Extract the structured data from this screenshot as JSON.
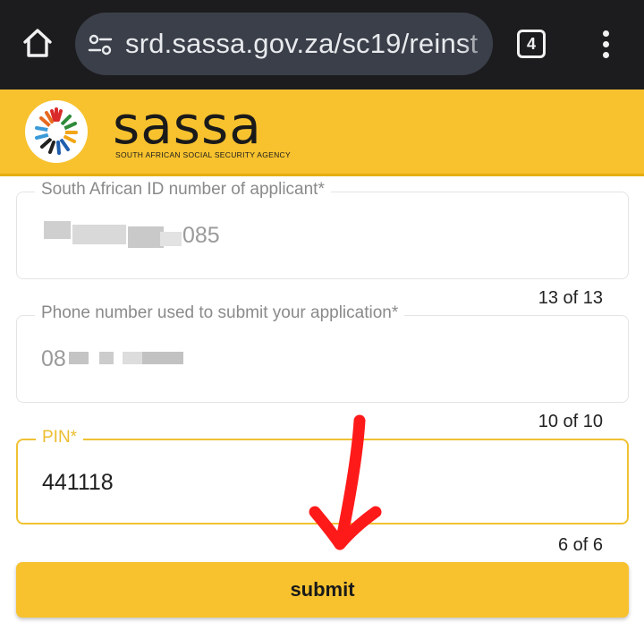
{
  "browser": {
    "url": "srd.sassa.gov.za/sc19/reinst",
    "tab_count": "4",
    "icons": [
      "home-icon",
      "page-info-icon",
      "tab-switcher-icon",
      "more-menu-icon"
    ]
  },
  "header": {
    "brand_name": "sassa",
    "brand_subtitle": "SOUTH AFRICAN SOCIAL SECURITY AGENCY"
  },
  "form": {
    "id_field": {
      "label": "South African ID number of applicant*",
      "value_visible_suffix": "085",
      "counter": "13 of 13"
    },
    "phone_field": {
      "label": "Phone number used to submit your application*",
      "value_visible_prefix": "08",
      "counter": "10 of 10"
    },
    "pin_field": {
      "label": "PIN*",
      "value": "441118",
      "counter": "6 of 6"
    },
    "submit_label": "submit"
  },
  "colors": {
    "brand_yellow": "#f7c22e",
    "pin_focus_border": "#f0c232",
    "annotation_red": "#ff1a1a",
    "chrome_dark": "#1c1c1e"
  }
}
